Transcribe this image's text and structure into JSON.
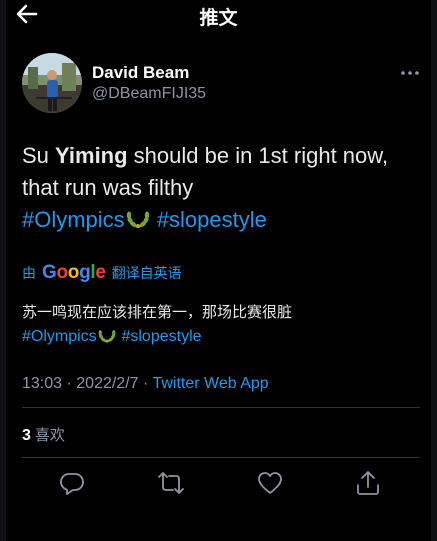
{
  "header": {
    "title": "推文"
  },
  "tweet": {
    "display_name": "David Beam",
    "handle": "@DBeamFIJI35",
    "text_prefix": "Su ",
    "text_bold": "Yiming",
    "text_rest": " should be in 1st right now, that run was filthy",
    "hashtag_1": "#Olympics",
    "hashtag_2": "#slopestyle"
  },
  "translation": {
    "by_label": "由",
    "google": "Google",
    "action_label": "翻译自英语",
    "text": "苏一鸣现在应该排在第一，那场比赛很脏",
    "hashtag_1": "#Olympics",
    "hashtag_2": "#slopestyle"
  },
  "meta": {
    "time": "13:03",
    "separator_1": " · ",
    "date": "2022/2/7",
    "separator_2": " · ",
    "source_app": "Twitter Web App"
  },
  "stats": {
    "likes_count": "3",
    "likes_label": "喜欢"
  },
  "icons": {
    "back": "arrow-left-icon",
    "more": "more-horizontal-icon",
    "reply": "reply-icon",
    "retweet": "retweet-icon",
    "like": "heart-icon",
    "share": "share-icon",
    "emoji": "laurel-wreath-emoji"
  },
  "colors": {
    "background": "#000000",
    "link": "#1d9bf0",
    "secondary": "#8b98a5",
    "divider": "#2f3336"
  }
}
